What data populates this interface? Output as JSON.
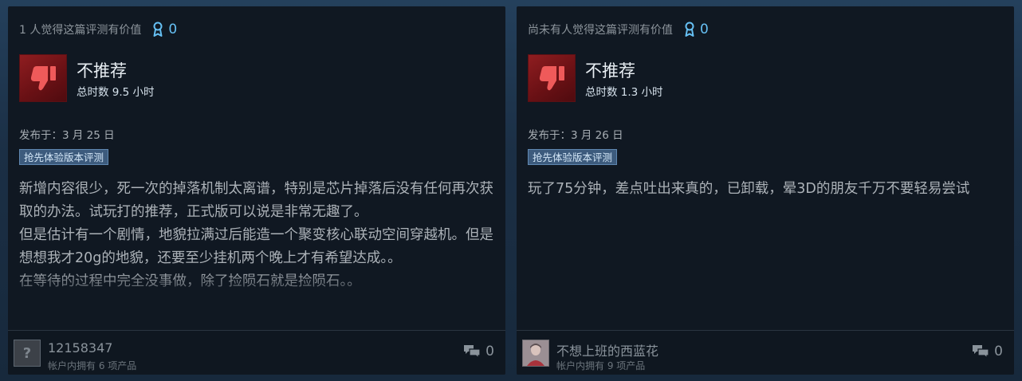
{
  "reviews": [
    {
      "helpful_text": "1 人觉得这篇评测有价值",
      "award_count": "0",
      "verdict": "不推荐",
      "hours": "总时数 9.5 小时",
      "posted": "发布于：3 月 25 日",
      "tag": "抢先体验版本评测",
      "body": "新增内容很少，死一次的掉落机制太离谱，特别是芯片掉落后没有任何再次获取的办法。试玩打的推荐，正式版可以说是非常无趣了。\n但是估计有一个剧情，地貌拉满过后能造一个聚变核心联动空间穿越机。但是想想我才20g的地貌，还要至少挂机两个晚上才有希望达成。。\n在等待的过程中完全没事做，除了捡陨石就是捡陨石。。",
      "user_name": "12158347",
      "products_owned": "帐户内拥有 6 项产品",
      "comment_count": "0"
    },
    {
      "helpful_text": "尚未有人觉得这篇评测有价值",
      "award_count": "0",
      "verdict": "不推荐",
      "hours": "总时数 1.3 小时",
      "posted": "发布于：3 月 26 日",
      "tag": "抢先体验版本评测",
      "body": "玩了75分钟，差点吐出来真的，已卸载，晕3D的朋友千万不要轻易尝试",
      "user_name": "不想上班的西蓝花",
      "products_owned": "帐户内拥有 9 项产品",
      "comment_count": "0"
    }
  ],
  "icons": {
    "award": "award-ribbon-icon",
    "verdict": "thumbs-down-icon",
    "comments": "comment-bubbles-icon",
    "avatar_placeholder": "question-mark-icon"
  },
  "colors": {
    "award_accent": "#66c0f4",
    "thumbs_down_bg": "#7a151a",
    "tag_bg": "#3d5b7d",
    "card_bg": "#101822"
  }
}
